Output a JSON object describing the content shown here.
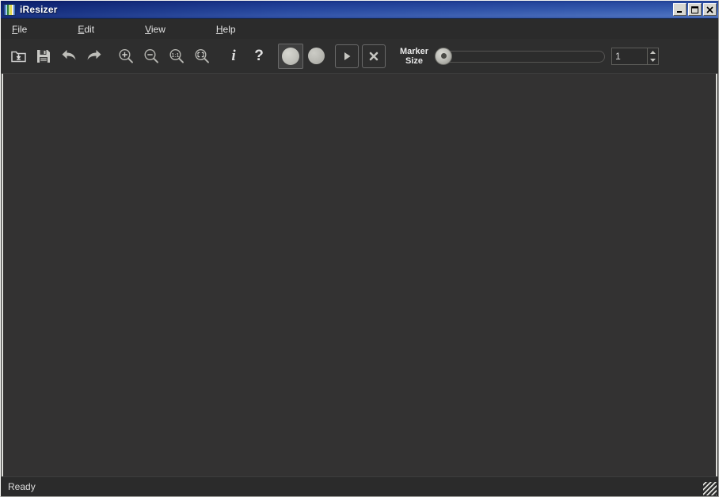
{
  "window": {
    "title": "iResizer",
    "icon": "striped-app-icon",
    "controls": [
      {
        "name": "minimize-button",
        "label": "_",
        "icon": "minimize-icon"
      },
      {
        "name": "maximize-button",
        "label": "□",
        "icon": "maximize-icon"
      },
      {
        "name": "close-button",
        "label": "×",
        "icon": "close-icon"
      }
    ]
  },
  "menubar": {
    "items": [
      {
        "label": "File",
        "accel": "F",
        "rest": "ile"
      },
      {
        "label": "Edit",
        "accel": "E",
        "rest": "dit"
      },
      {
        "label": "View",
        "accel": "V",
        "rest": "iew"
      },
      {
        "label": "Help",
        "accel": "H",
        "rest": "elp"
      }
    ]
  },
  "toolbar": {
    "buttons": [
      {
        "name": "open-button",
        "icon": "open-folder-icon",
        "tooltip": "Open"
      },
      {
        "name": "save-button",
        "icon": "floppy-disk-save-icon",
        "tooltip": "Save"
      },
      {
        "name": "undo-button",
        "icon": "undo-arrow-icon",
        "tooltip": "Undo"
      },
      {
        "name": "redo-button",
        "icon": "redo-arrow-icon",
        "tooltip": "Redo"
      },
      {
        "name": "zoom-in-button",
        "icon": "magnifier-plus-icon",
        "tooltip": "Zoom In"
      },
      {
        "name": "zoom-out-button",
        "icon": "magnifier-minus-icon",
        "tooltip": "Zoom Out"
      },
      {
        "name": "zoom-actual-size-button",
        "icon": "magnifier-one-to-one-icon",
        "tooltip": "Actual Size"
      },
      {
        "name": "zoom-fit-button",
        "icon": "magnifier-fit-icon",
        "tooltip": "Fit To Window"
      },
      {
        "name": "info-button",
        "icon": "info-i-icon",
        "glyph": "i",
        "tooltip": "Info"
      },
      {
        "name": "help-button",
        "icon": "question-mark-icon",
        "glyph": "?",
        "tooltip": "Help"
      }
    ],
    "marker_protect": {
      "name": "marker-protect-button",
      "icon": "filled-circle-icon",
      "checked": true
    },
    "marker_remove": {
      "name": "marker-remove-button",
      "icon": "filled-circle-icon",
      "checked": false
    },
    "run_button": {
      "name": "run-resize-button",
      "icon": "play-triangle-icon"
    },
    "clear_button": {
      "name": "clear-markers-button",
      "icon": "x-cross-icon"
    },
    "marker_size": {
      "label_line1": "Marker",
      "label_line2": "Size",
      "slider_value": 1,
      "slider_min": 1,
      "slider_max": 100,
      "spin_value": "1"
    }
  },
  "statusbar": {
    "message": "Ready"
  },
  "canvas": {
    "background_color": "#333232",
    "content": ""
  },
  "colors": {
    "titlebar_start": "#2c4a94",
    "titlebar_end": "#8fb0e0",
    "chrome": "#2b2b2b",
    "toolbar": "#2e2e2e",
    "canvas": "#333232",
    "text": "#e4e4e4"
  }
}
